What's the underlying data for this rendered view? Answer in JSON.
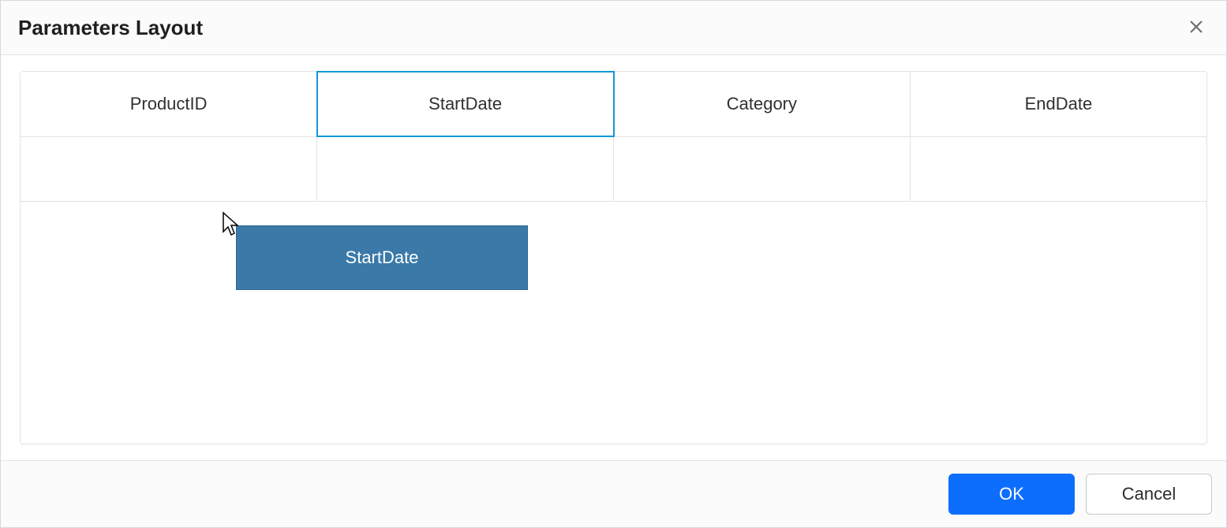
{
  "dialog": {
    "title": "Parameters Layout"
  },
  "grid": {
    "rows": [
      {
        "cells": [
          {
            "label": "ProductID",
            "selected": false
          },
          {
            "label": "StartDate",
            "selected": true
          },
          {
            "label": "Category",
            "selected": false
          },
          {
            "label": "EndDate",
            "selected": false
          }
        ]
      },
      {
        "cells": [
          {
            "label": "",
            "selected": false
          },
          {
            "label": "",
            "selected": false
          },
          {
            "label": "",
            "selected": false
          },
          {
            "label": "",
            "selected": false
          }
        ]
      }
    ]
  },
  "drag": {
    "label": "StartDate"
  },
  "footer": {
    "ok_label": "OK",
    "cancel_label": "Cancel"
  }
}
